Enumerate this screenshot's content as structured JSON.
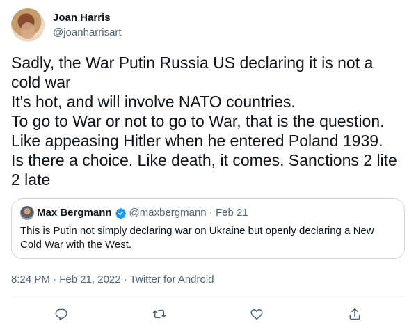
{
  "tweet": {
    "author_name": "Joan Harris",
    "author_handle": "@joanharrisart",
    "text": "Sadly, the War Putin Russia US declaring it is not a cold war\nIt's hot, and will involve NATO  countries.\nTo go to War or not to go to War, that is the question.\nLike appeasing Hitler when he entered Poland 1939.\nIs there a choice. Like death, it comes.  Sanctions 2 lite 2 late",
    "timestamp": "8:24 PM · Feb 21, 2022 · Twitter for Android"
  },
  "quote": {
    "author_name": "Max Bergmann",
    "author_handle": "@maxbergmann",
    "separator": "·",
    "date": "Feb 21",
    "text": "This is Putin not simply declaring war on Ukraine but openly declaring a New Cold War with the West."
  },
  "icons": {
    "reply": "reply-icon",
    "retweet": "retweet-icon",
    "like": "like-icon",
    "share": "share-icon",
    "verified": "verified-badge-icon"
  },
  "colors": {
    "text": "#0f1419",
    "secondary": "#536471",
    "border": "#cfd9de",
    "verified": "#1d9bf0"
  }
}
